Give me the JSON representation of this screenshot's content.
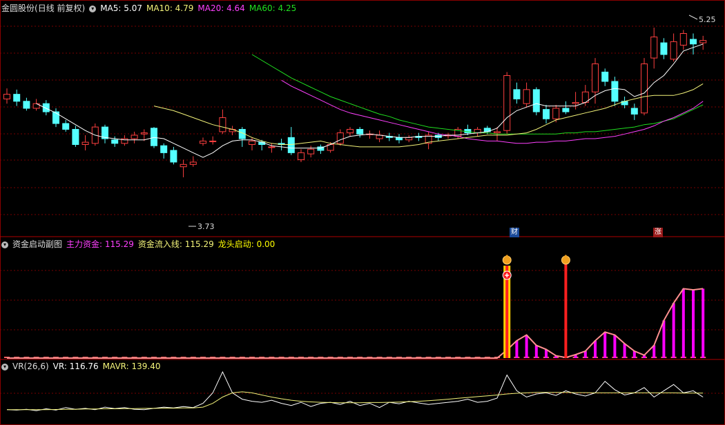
{
  "main_panel": {
    "stock_name": "金圆股份",
    "period_label": "(日线 前复权)",
    "ma": [
      {
        "label": "MA5: 5.07",
        "color": "#ffffff"
      },
      {
        "label": "MA10: 4.79",
        "color": "#f4f47a"
      },
      {
        "label": "MA20: 4.64",
        "color": "#ff40ff"
      },
      {
        "label": "MA60: 4.25",
        "color": "#20e020"
      }
    ],
    "high_label": "5.25",
    "low_label": "3.73",
    "event_markers": [
      "财",
      "涨"
    ]
  },
  "indicator_panel": {
    "title": "资金启动副图",
    "main_fund": "主力资金: 115.29",
    "inflow_line": "资金流入线: 115.29",
    "leader_start": "龙头启动: 0.00"
  },
  "vr_panel": {
    "title": "VR(26,6)",
    "vr": "VR: 116.76",
    "mavr": "MAVR: 139.40"
  },
  "colors": {
    "up": "#ff4040",
    "down": "#54ffff",
    "grid": "#7a0000",
    "ma5": "#ffffff",
    "ma10": "#f4f47a",
    "ma20": "#ff40ff",
    "ma60": "#20e020",
    "bars": "#ff00ff"
  },
  "chart_data": [
    {
      "type": "candlestick",
      "title": "金圆股份 (日线 前复权)",
      "ylim": [
        3.5,
        5.4
      ],
      "candles": [
        [
          4.66,
          4.7,
          4.75,
          4.62
        ],
        [
          4.7,
          4.64,
          4.74,
          4.6
        ],
        [
          4.64,
          4.58,
          4.67,
          4.56
        ],
        [
          4.58,
          4.62,
          4.66,
          4.56
        ],
        [
          4.62,
          4.55,
          4.65,
          4.52
        ],
        [
          4.55,
          4.45,
          4.58,
          4.42
        ],
        [
          4.45,
          4.4,
          4.48,
          4.38
        ],
        [
          4.4,
          4.27,
          4.43,
          4.25
        ],
        [
          4.27,
          4.29,
          4.35,
          4.22
        ],
        [
          4.28,
          4.42,
          4.45,
          4.26
        ],
        [
          4.42,
          4.32,
          4.44,
          4.28
        ],
        [
          4.31,
          4.28,
          4.34,
          4.25
        ],
        [
          4.28,
          4.32,
          4.35,
          4.26
        ],
        [
          4.32,
          4.35,
          4.38,
          4.28
        ],
        [
          4.36,
          4.37,
          4.4,
          4.3
        ],
        [
          4.41,
          4.26,
          4.42,
          4.24
        ],
        [
          4.26,
          4.2,
          4.28,
          4.15
        ],
        [
          4.22,
          4.12,
          4.25,
          4.1
        ],
        [
          4.08,
          4.1,
          4.14,
          3.99
        ],
        [
          4.1,
          4.12,
          4.17,
          4.08
        ],
        [
          4.28,
          4.3,
          4.33,
          4.26
        ],
        [
          4.3,
          4.3,
          4.34,
          4.27
        ],
        [
          4.38,
          4.5,
          4.57,
          4.36
        ],
        [
          4.38,
          4.4,
          4.43,
          4.35
        ],
        [
          4.4,
          4.32,
          4.42,
          4.25
        ],
        [
          4.27,
          4.3,
          4.33,
          4.22
        ],
        [
          4.29,
          4.27,
          4.31,
          4.22
        ],
        [
          4.25,
          4.25,
          4.28,
          4.2
        ],
        [
          4.28,
          4.27,
          4.32,
          4.22
        ],
        [
          4.33,
          4.2,
          4.42,
          4.18
        ],
        [
          4.14,
          4.2,
          4.23,
          4.12
        ],
        [
          4.19,
          4.23,
          4.26,
          4.16
        ],
        [
          4.25,
          4.22,
          4.27,
          4.19
        ],
        [
          4.22,
          4.27,
          4.29,
          4.2
        ],
        [
          4.28,
          4.37,
          4.4,
          4.26
        ],
        [
          4.37,
          4.4,
          4.42,
          4.34
        ],
        [
          4.4,
          4.36,
          4.42,
          4.33
        ],
        [
          4.36,
          4.36,
          4.39,
          4.32
        ],
        [
          4.32,
          4.35,
          4.39,
          4.29
        ],
        [
          4.34,
          4.33,
          4.37,
          4.3
        ],
        [
          4.33,
          4.31,
          4.36,
          4.28
        ],
        [
          4.31,
          4.33,
          4.35,
          4.29
        ],
        [
          4.34,
          4.33,
          4.37,
          4.3
        ],
        [
          4.28,
          4.35,
          4.38,
          4.23
        ],
        [
          4.35,
          4.33,
          4.37,
          4.3
        ],
        [
          4.35,
          4.35,
          4.37,
          4.32
        ],
        [
          4.34,
          4.4,
          4.42,
          4.32
        ],
        [
          4.4,
          4.37,
          4.44,
          4.35
        ],
        [
          4.37,
          4.4,
          4.42,
          4.34
        ],
        [
          4.41,
          4.38,
          4.43,
          4.36
        ],
        [
          4.37,
          4.38,
          4.42,
          4.3
        ],
        [
          4.39,
          4.86,
          4.89,
          4.36
        ],
        [
          4.74,
          4.66,
          4.8,
          4.62
        ],
        [
          4.62,
          4.74,
          4.8,
          4.59
        ],
        [
          4.74,
          4.55,
          4.76,
          4.52
        ],
        [
          4.57,
          4.49,
          4.61,
          4.45
        ],
        [
          4.49,
          4.58,
          4.61,
          4.46
        ],
        [
          4.58,
          4.55,
          4.64,
          4.53
        ],
        [
          4.62,
          4.63,
          4.72,
          4.57
        ],
        [
          4.63,
          4.72,
          4.78,
          4.6
        ],
        [
          4.72,
          4.96,
          5.01,
          4.62
        ],
        [
          4.89,
          4.81,
          4.92,
          4.77
        ],
        [
          4.81,
          4.64,
          4.85,
          4.6
        ],
        [
          4.64,
          4.61,
          4.68,
          4.58
        ],
        [
          4.58,
          4.53,
          4.62,
          4.48
        ],
        [
          4.54,
          4.96,
          5.01,
          4.52
        ],
        [
          5.01,
          5.19,
          5.27,
          4.92
        ],
        [
          5.14,
          5.04,
          5.18,
          5.0
        ],
        [
          5.0,
          5.15,
          5.22,
          4.98
        ],
        [
          5.12,
          5.22,
          5.25,
          5.08
        ],
        [
          5.17,
          5.13,
          5.22,
          5.04
        ],
        [
          5.14,
          5.16,
          5.2,
          5.08
        ]
      ],
      "ma5": [
        4.62,
        4.58,
        4.54,
        4.49,
        4.44,
        4.39,
        4.35,
        4.33,
        4.32,
        4.31,
        4.31,
        4.31,
        4.33,
        4.32,
        4.28,
        4.24,
        4.2,
        4.16,
        4.2,
        4.26,
        4.3,
        4.31,
        4.31,
        4.29,
        4.26,
        4.25,
        4.24,
        4.24,
        4.24,
        4.24,
        4.27,
        4.31,
        4.34,
        4.35,
        4.36,
        4.35,
        4.34,
        4.33,
        4.33,
        4.34,
        4.34,
        4.34,
        4.35,
        4.35,
        4.36,
        4.37,
        4.38,
        4.41,
        4.5,
        4.56,
        4.59,
        4.62,
        4.6,
        4.6,
        4.6,
        4.6,
        4.63,
        4.69,
        4.73,
        4.75,
        4.74,
        4.68,
        4.71,
        4.8,
        4.86,
        4.96,
        5.07,
        5.1,
        5.13
      ],
      "ma10": [
        4.6,
        4.58,
        4.56,
        4.53,
        4.5,
        4.47,
        4.44,
        4.42,
        4.4,
        4.37,
        4.33,
        4.3,
        4.28,
        4.27,
        4.27,
        4.28,
        4.29,
        4.3,
        4.28,
        4.27,
        4.26,
        4.25,
        4.25,
        4.25,
        4.25,
        4.25,
        4.26,
        4.27,
        4.29,
        4.3,
        4.31,
        4.32,
        4.33,
        4.34,
        4.35,
        4.35,
        4.35,
        4.36,
        4.37,
        4.4,
        4.44,
        4.48,
        4.5,
        4.52,
        4.54,
        4.56,
        4.58,
        4.61,
        4.64,
        4.66,
        4.68,
        4.69,
        4.69,
        4.69,
        4.71,
        4.74,
        4.79
      ],
      "ma20": [
        4.82,
        4.77,
        4.73,
        4.69,
        4.65,
        4.61,
        4.57,
        4.54,
        4.52,
        4.5,
        4.48,
        4.46,
        4.44,
        4.42,
        4.4,
        4.38,
        4.36,
        4.35,
        4.34,
        4.32,
        4.31,
        4.3,
        4.3,
        4.29,
        4.28,
        4.28,
        4.29,
        4.29,
        4.3,
        4.3,
        4.31,
        4.32,
        4.32,
        4.33,
        4.34,
        4.36,
        4.38,
        4.4,
        4.43,
        4.47,
        4.5,
        4.54,
        4.58,
        4.64
      ],
      "ma60": [
        5.04,
        4.99,
        4.94,
        4.89,
        4.84,
        4.8,
        4.76,
        4.72,
        4.68,
        4.65,
        4.62,
        4.59,
        4.56,
        4.53,
        4.51,
        4.48,
        4.46,
        4.44,
        4.42,
        4.41,
        4.4,
        4.39,
        4.38,
        4.37,
        4.37,
        4.36,
        4.36,
        4.36,
        4.36,
        4.36,
        4.36,
        4.36,
        4.37,
        4.37,
        4.38,
        4.38,
        4.39,
        4.4,
        4.41,
        4.42,
        4.44,
        4.45,
        4.47,
        4.49,
        4.53,
        4.57,
        4.61
      ]
    },
    {
      "type": "bar",
      "title": "资金启动副图",
      "series": [
        {
          "name": "主力资金",
          "values": [
            0,
            0,
            0,
            0,
            0,
            0,
            0,
            0,
            0,
            0,
            0,
            0,
            0,
            0,
            0,
            0,
            0,
            0,
            0,
            0,
            0,
            0,
            0,
            0,
            0,
            0,
            0,
            0,
            0,
            0,
            0,
            0,
            0,
            0,
            0,
            0,
            0,
            0,
            0,
            0,
            0,
            0,
            0,
            0,
            0,
            0,
            0,
            0,
            0,
            0,
            0,
            14,
            30,
            40,
            22,
            15,
            4,
            1,
            6,
            12,
            30,
            45,
            40,
            25,
            12,
            5,
            22,
            65,
            95,
            120,
            118,
            120
          ]
        }
      ],
      "markers": [
        51,
        57
      ]
    },
    {
      "type": "line",
      "title": "VR(26,6)",
      "series": [
        {
          "name": "VR",
          "values": [
            60,
            58,
            62,
            55,
            64,
            58,
            70,
            62,
            66,
            60,
            72,
            65,
            70,
            62,
            60,
            66,
            72,
            68,
            75,
            70,
            90,
            140,
            240,
            140,
            110,
            100,
            95,
            105,
            90,
            80,
            95,
            75,
            90,
            95,
            85,
            100,
            80,
            90,
            70,
            95,
            88,
            100,
            92,
            85,
            90,
            95,
            100,
            110,
            95,
            100,
            115,
            225,
            150,
            120,
            135,
            140,
            128,
            150,
            135,
            125,
            140,
            195,
            155,
            130,
            140,
            165,
            120,
            150,
            180,
            140,
            150,
            120
          ]
        },
        {
          "name": "MAVR",
          "values": [
            60,
            60,
            60,
            60,
            60,
            61,
            62,
            62,
            63,
            63,
            64,
            64,
            65,
            65,
            66,
            66,
            67,
            67,
            68,
            68,
            72,
            90,
            120,
            140,
            145,
            140,
            130,
            120,
            112,
            105,
            100,
            97,
            95,
            94,
            93,
            93,
            93,
            94,
            94,
            95,
            96,
            98,
            100,
            103,
            106,
            110,
            114,
            118,
            122,
            126,
            130,
            135,
            138,
            140,
            142,
            142,
            142,
            142,
            141,
            141,
            140,
            140,
            140,
            140,
            140,
            140,
            140,
            140,
            140,
            139,
            139,
            139
          ]
        }
      ]
    }
  ]
}
